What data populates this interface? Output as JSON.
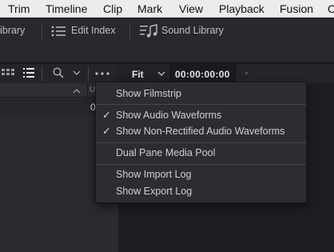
{
  "menubar": {
    "items": [
      "Trim",
      "Timeline",
      "Clip",
      "Mark",
      "View",
      "Playback",
      "Fusion",
      "C"
    ]
  },
  "toolbar": {
    "media_library_label": "ibrary",
    "edit_index_label": "Edit Index",
    "sound_library_label": "Sound Library"
  },
  "subbar": {
    "fit_label": "Fit",
    "timecode": "00:00:00:00"
  },
  "left_panel": {
    "column_header": "U",
    "row_value": "0"
  },
  "dropdown": {
    "items": [
      {
        "label": "Show Filmstrip",
        "checked": false
      },
      {
        "label": "Show Audio Waveforms",
        "checked": true
      },
      {
        "label": "Show Non-Rectified Audio Waveforms",
        "checked": true
      },
      {
        "label": "Dual Pane Media Pool",
        "checked": false
      },
      {
        "label": "Show Import Log",
        "checked": false
      },
      {
        "label": "Show Export Log",
        "checked": false
      }
    ],
    "check_glyph": "✓"
  },
  "colors": {
    "menu_bg": "#2c2c31",
    "toolbar_bg": "#28282e",
    "menubar_bg": "#ececec"
  }
}
